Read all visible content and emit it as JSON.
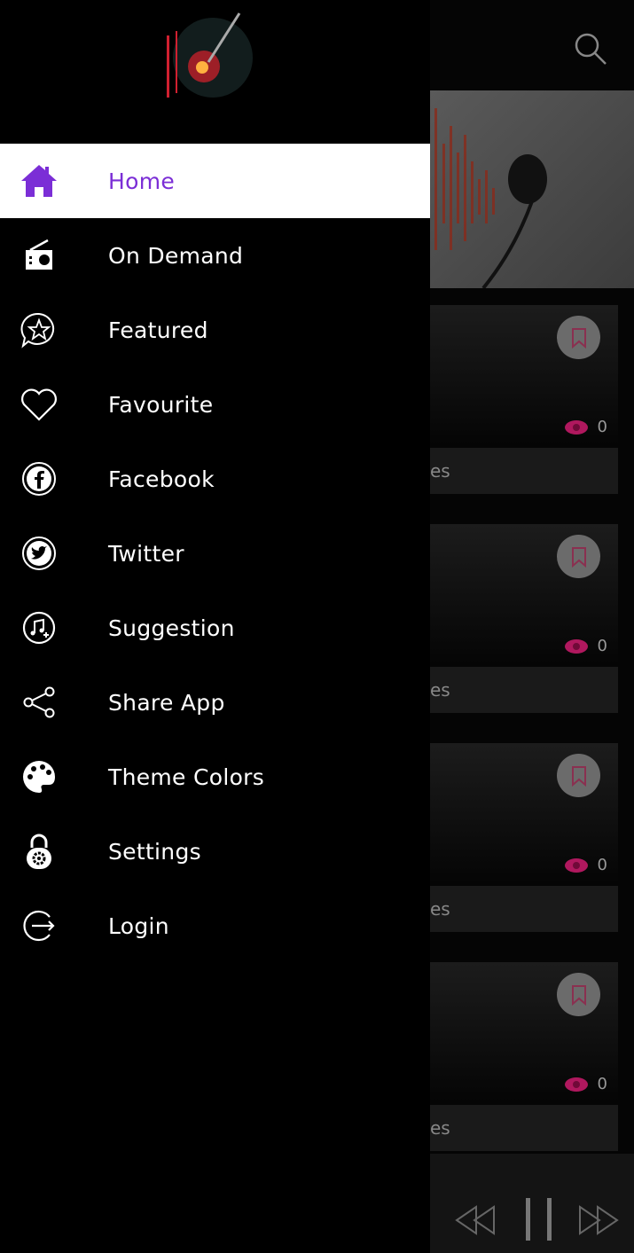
{
  "colors": {
    "accent": "#7b2ed6",
    "eye": "#b0185e",
    "drawer_bg": "#000000"
  },
  "drawer": {
    "items": [
      {
        "label": "Home",
        "icon": "home-icon",
        "active": true
      },
      {
        "label": "On Demand",
        "icon": "radio-icon"
      },
      {
        "label": "Featured",
        "icon": "star-bubble-icon"
      },
      {
        "label": "Favourite",
        "icon": "heart-icon"
      },
      {
        "label": "Facebook",
        "icon": "facebook-icon"
      },
      {
        "label": "Twitter",
        "icon": "twitter-icon"
      },
      {
        "label": "Suggestion",
        "icon": "music-add-icon"
      },
      {
        "label": "Share App",
        "icon": "share-icon"
      },
      {
        "label": "Theme Colors",
        "icon": "palette-icon"
      },
      {
        "label": "Settings",
        "icon": "lock-gear-icon"
      },
      {
        "label": "Login",
        "icon": "logout-icon"
      }
    ]
  },
  "cards": [
    {
      "views": "0",
      "label": "es"
    },
    {
      "views": "0",
      "label": "es"
    },
    {
      "views": "0",
      "label": "es"
    },
    {
      "views": "0",
      "label": "es"
    }
  ]
}
